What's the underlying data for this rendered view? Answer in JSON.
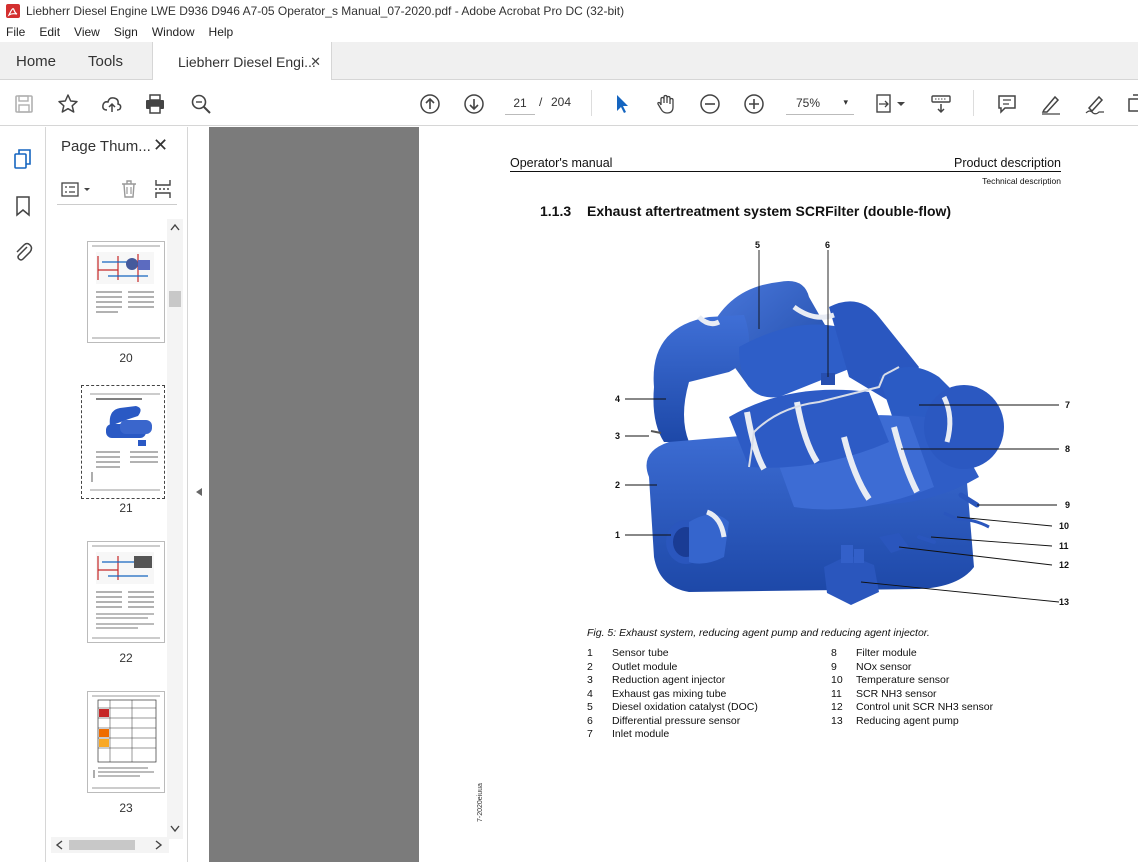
{
  "window": {
    "title": "Liebherr Diesel Engine LWE D936 D946 A7-05 Operator_s Manual_07-2020.pdf - Adobe Acrobat Pro DC (32-bit)"
  },
  "menu": {
    "items": [
      "File",
      "Edit",
      "View",
      "Sign",
      "Window",
      "Help"
    ]
  },
  "tabs": {
    "home": "Home",
    "tools": "Tools",
    "document": "Liebherr Diesel Engi...",
    "close": "✕"
  },
  "toolbar": {
    "current_page": "21",
    "page_sep": "/",
    "total_pages": "204",
    "zoom": "75%",
    "zoom_caret": "▾"
  },
  "thumbnails": {
    "panel_title": "Page Thum...",
    "close": "✕",
    "pages": [
      "20",
      "21",
      "22",
      "23"
    ],
    "selected": "21"
  },
  "document": {
    "header_left": "Operator's manual",
    "header_right": "Product description",
    "header_sub": "Technical description",
    "section_number": "1.1.3",
    "section_title": "Exhaust aftertreatment system SCRFilter (double-flow)",
    "figure_caption": "Fig. 5: Exhaust system, reducing agent pump and reducing agent injector.",
    "side_code": "7-2020eiuua",
    "callouts": [
      "1",
      "2",
      "3",
      "4",
      "5",
      "6",
      "7",
      "8",
      "9",
      "10",
      "11",
      "12",
      "13"
    ],
    "legend_left": [
      {
        "num": "1",
        "label": "Sensor tube"
      },
      {
        "num": "2",
        "label": "Outlet module"
      },
      {
        "num": "3",
        "label": "Reduction agent injector"
      },
      {
        "num": "4",
        "label": "Exhaust gas mixing tube"
      },
      {
        "num": "5",
        "label": "Diesel oxidation catalyst (DOC)"
      },
      {
        "num": "6",
        "label": "Differential pressure sensor"
      },
      {
        "num": "7",
        "label": "Inlet module"
      }
    ],
    "legend_right": [
      {
        "num": "8",
        "label": "Filter module"
      },
      {
        "num": "9",
        "label": "NOx sensor"
      },
      {
        "num": "10",
        "label": "Temperature sensor"
      },
      {
        "num": "11",
        "label": "SCR NH3 sensor"
      },
      {
        "num": "12",
        "label": "Control unit SCR NH3 sensor"
      },
      {
        "num": "13",
        "label": "Reducing agent pump"
      }
    ]
  },
  "colors": {
    "accent": "#1565c0",
    "part_blue": "#2a59c4",
    "viewer_bg": "#7b7b7b"
  }
}
